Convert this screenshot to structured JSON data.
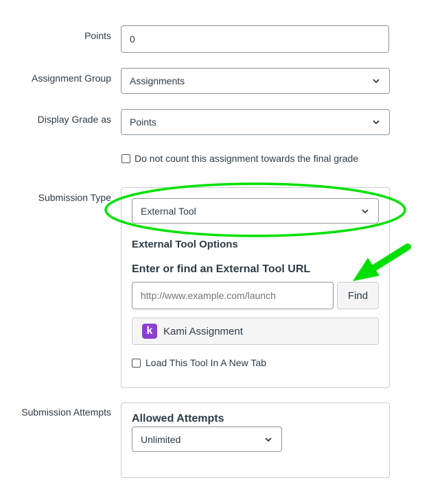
{
  "points": {
    "label": "Points",
    "value": "0"
  },
  "assignment_group": {
    "label": "Assignment Group",
    "selected": "Assignments"
  },
  "display_grade": {
    "label": "Display Grade as",
    "selected": "Points"
  },
  "final_grade_checkbox": {
    "label": "Do not count this assignment towards the final grade",
    "checked": false
  },
  "submission_type": {
    "label": "Submission Type",
    "selected": "External Tool",
    "options_heading": "External Tool Options",
    "url_heading": "Enter or find an External Tool URL",
    "url_placeholder": "http://www.example.com/launch",
    "find_label": "Find",
    "tool_name": "Kami Assignment",
    "tool_logo_letter": "k",
    "new_tab_label": "Load This Tool In A New Tab",
    "new_tab_checked": false
  },
  "submission_attempts": {
    "label": "Submission Attempts",
    "allowed_heading": "Allowed Attempts",
    "selected": "Unlimited"
  },
  "colors": {
    "annotation": "#00e000",
    "kami_purple": "#8a3fd1"
  }
}
